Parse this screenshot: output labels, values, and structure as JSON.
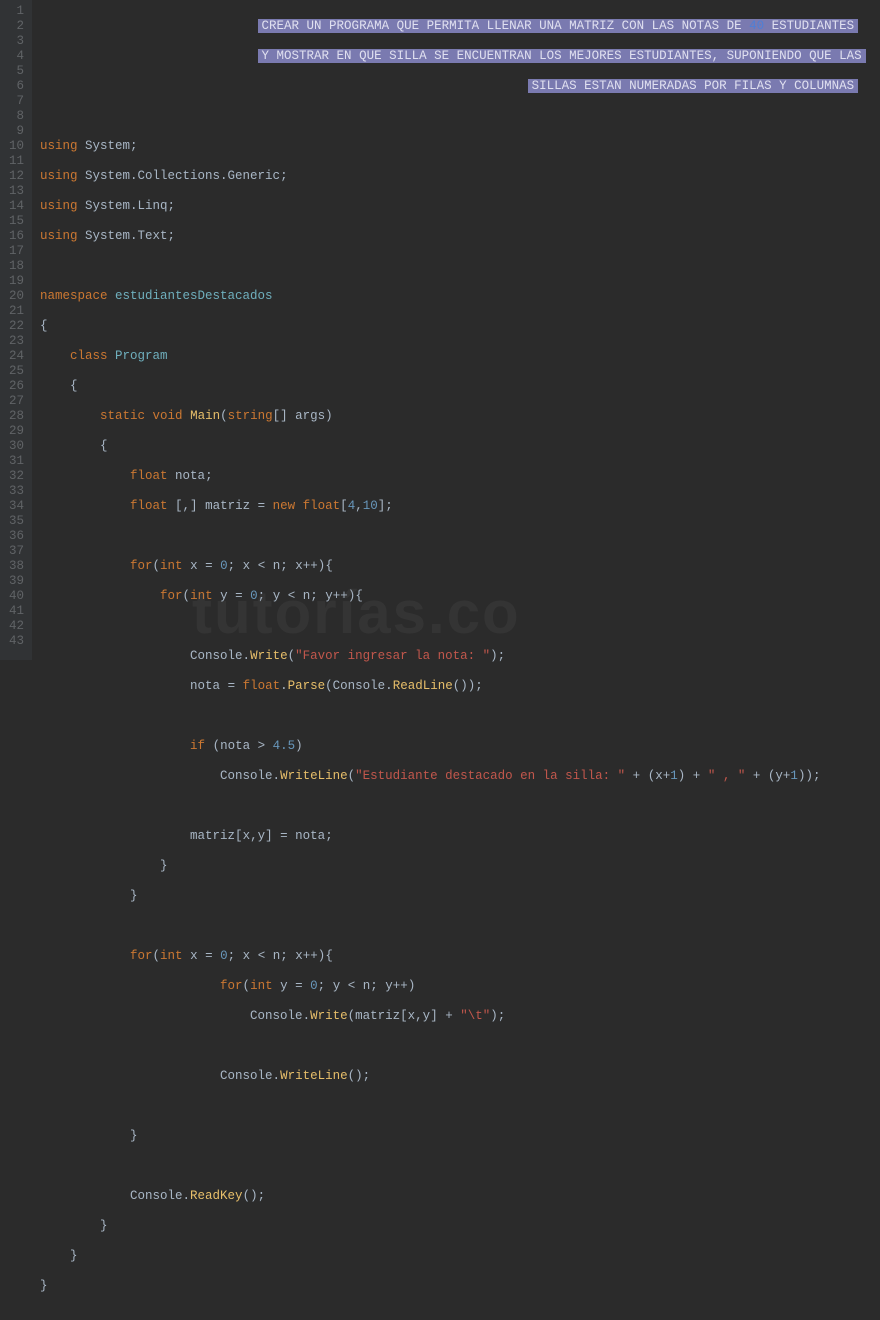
{
  "lineNumbers": [
    "1",
    "2",
    "3",
    "4",
    "5",
    "6",
    "7",
    "8",
    "9",
    "10",
    "11",
    "12",
    "13",
    "14",
    "15",
    "16",
    "17",
    "18",
    "19",
    "20",
    "21",
    "22",
    "23",
    "24",
    "25",
    "26",
    "27",
    "28",
    "29",
    "30",
    "31",
    "32",
    "33",
    "34",
    "35",
    "36",
    "37",
    "38",
    "39",
    "40",
    "41",
    "42",
    "43"
  ],
  "banner": {
    "line1_pre": "CREAR UN PROGRAMA QUE PERMITA LLENAR UNA MATRIZ CON LAS NOTAS DE ",
    "line1_num": "40",
    "line1_post": " ESTUDIANTES",
    "line2": "Y MOSTRAR EN QUE SILLA SE ENCUENTRAN LOS MEJORES ESTUDIANTES, SUPONIENDO QUE LAS",
    "line3": "SILLAS ESTAN NUMERADAS POR FILAS Y COLUMNAS"
  },
  "code": {
    "using": "using",
    "system": "System",
    "collections": "System.Collections.Generic",
    "linq": "System.Linq",
    "text": "System.Text",
    "namespace_kw": "namespace",
    "namespace_name": "estudiantesDestacados",
    "class_kw": "class",
    "class_name": "Program",
    "static": "static",
    "void": "void",
    "main": "Main",
    "string_arr": "string",
    "args": "args",
    "float": "float",
    "nota": "nota",
    "matriz": "matriz",
    "new": "new",
    "dim1": "4",
    "dim2": "10",
    "for": "for",
    "int": "int",
    "x": "x",
    "y": "y",
    "zero": "0",
    "n": "n",
    "Console": "Console",
    "Write": "Write",
    "WriteLine": "WriteLine",
    "ReadLine": "ReadLine",
    "ReadKey": "ReadKey",
    "Parse": "Parse",
    "str_favor": "\"Favor ingresar la nota: \"",
    "if": "if",
    "gt45": "4.5",
    "str_dest": "\"Estudiante destacado en la silla: \"",
    "str_comma": "\" , \"",
    "one": "1",
    "str_tab": "\"\\t\"",
    "semicolon": ";",
    "lbrace": "{",
    "rbrace": "}",
    "lparen": "(",
    "rparen": ")",
    "lbracket": "[",
    "rbracket": "]",
    "comma": ",",
    "eq": "=",
    "plus": "+",
    "lt": "<",
    "gt": ">",
    "pp": "++",
    "dot": "."
  },
  "watermark": "tutorías.co"
}
